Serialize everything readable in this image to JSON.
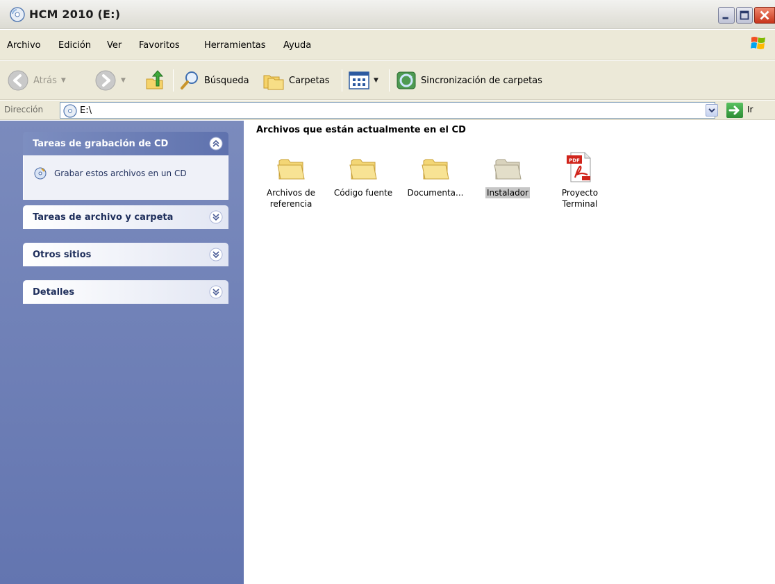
{
  "window": {
    "title": "HCM 2010 (E:)"
  },
  "menu": {
    "items": [
      "Archivo",
      "Edición",
      "Ver",
      "Favoritos",
      "Herramientas",
      "Ayuda"
    ]
  },
  "toolbar": {
    "back_label": "Atrás",
    "search_label": "Búsqueda",
    "folders_label": "Carpetas",
    "sync_label": "Sincronización de carpetas"
  },
  "address": {
    "label": "Dirección",
    "value": "E:\\",
    "go_label": "Ir"
  },
  "taskpane": {
    "panels": [
      {
        "title": "Tareas de grabación de CD",
        "expanded": true,
        "items": [
          "Grabar estos archivos en un CD"
        ]
      },
      {
        "title": "Tareas de archivo y carpeta",
        "expanded": false
      },
      {
        "title": "Otros sitios",
        "expanded": false
      },
      {
        "title": "Detalles",
        "expanded": false
      }
    ]
  },
  "content": {
    "heading": "Archivos que están actualmente en el CD",
    "files": [
      {
        "name_line1": "Archivos de",
        "name_line2": "referencia",
        "type": "folder-icon",
        "selected": false
      },
      {
        "name_line1": "Código fuente",
        "name_line2": "",
        "type": "folder-icon",
        "selected": false
      },
      {
        "name_line1": "Documenta...",
        "name_line2": "",
        "type": "folder-icon",
        "selected": false
      },
      {
        "name_line1": "Instalador",
        "name_line2": "",
        "type": "folder-icon",
        "selected": true
      },
      {
        "name_line1": "Proyecto",
        "name_line2": "Terminal",
        "type": "pdf-icon",
        "selected": false
      }
    ]
  },
  "colors": {
    "taskpane": "#6a7cb5",
    "panel_head_dark": "#5f72ae",
    "panel_text": "#1f2f5c",
    "selection": "#c6c6c6"
  }
}
